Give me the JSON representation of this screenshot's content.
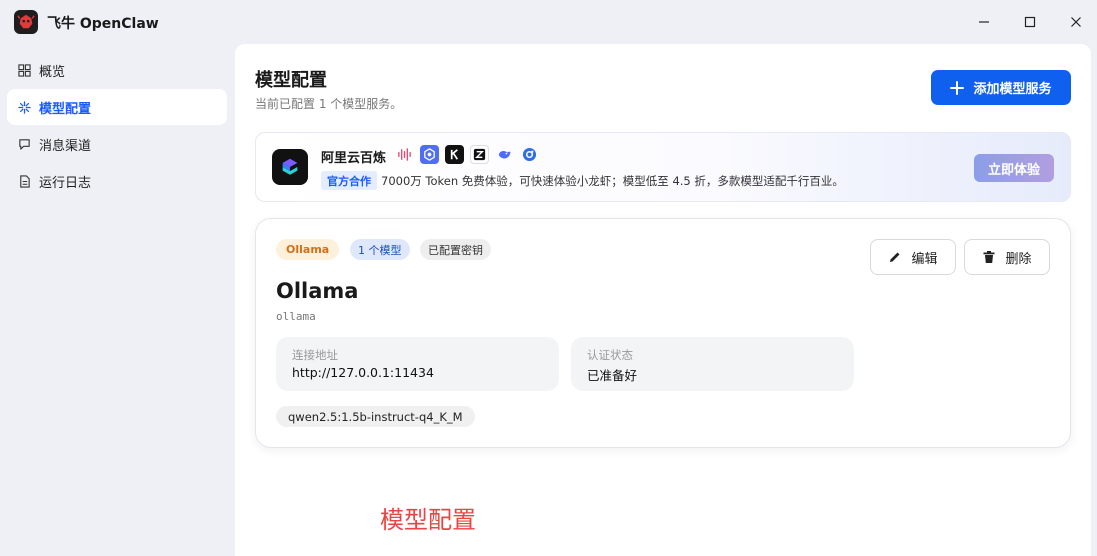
{
  "window": {
    "title": "飞牛 OpenClaw"
  },
  "sidebar": {
    "items": [
      {
        "label": "概览",
        "icon": "grid-icon",
        "active": false
      },
      {
        "label": "模型配置",
        "icon": "asterisk-icon",
        "active": true
      },
      {
        "label": "消息渠道",
        "icon": "chat-icon",
        "active": false
      },
      {
        "label": "运行日志",
        "icon": "document-icon",
        "active": false
      }
    ]
  },
  "header": {
    "title": "模型配置",
    "subtitle": "当前已配置 1 个模型服务。",
    "add_button_label": "添加模型服务"
  },
  "banner": {
    "title": "阿里云百炼",
    "tag": "官方合作",
    "description": "7000万 Token 免费体验，可快速体验小龙虾；模型低至 4.5 折，多款模型适配千行百业。",
    "cta_label": "立即体验",
    "brand_icons": [
      "waveform-icon",
      "qwen-icon",
      "kimi-icon",
      "zhipu-icon",
      "deepseek-icon",
      "minimax-icon"
    ]
  },
  "provider_card": {
    "provider_badge": "Ollama",
    "model_count_badge": "1 个模型",
    "key_badge": "已配置密钥",
    "edit_label": "编辑",
    "delete_label": "删除",
    "name": "Ollama",
    "slug": "ollama",
    "endpoint_label": "连接地址",
    "endpoint_value": "http://127.0.0.1:11434",
    "status_label": "认证状态",
    "status_value": "已准备好",
    "models": [
      "qwen2.5:1.5b-instruct-q4_K_M"
    ]
  },
  "overlay_caption": "模型配置",
  "colors": {
    "accent": "#1060f0",
    "provider_badge_bg": "#fdf1dc",
    "provider_badge_text": "#d2701a",
    "caption": "#e84545"
  }
}
